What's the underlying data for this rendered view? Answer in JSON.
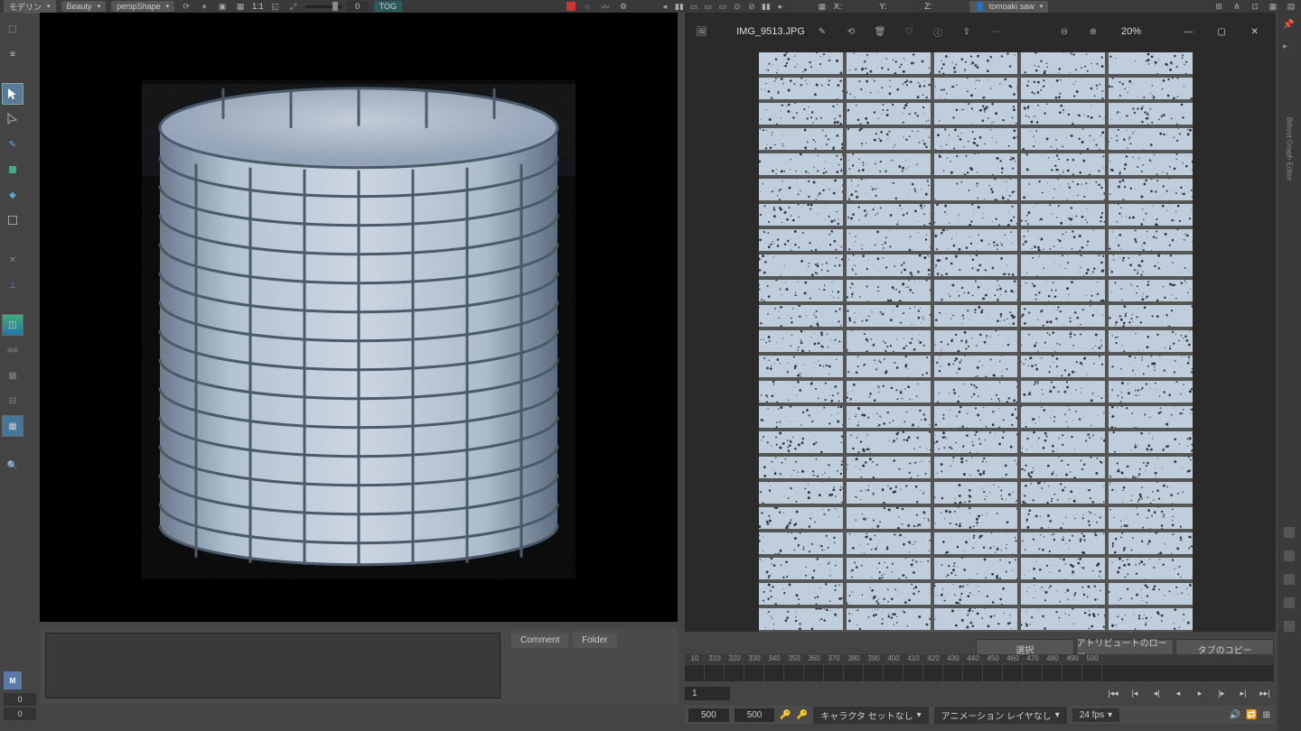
{
  "topbar": {
    "mode": "モデリン",
    "render_mode": "Beauty",
    "camera": "perspShape",
    "ratio": "1:1",
    "zero": "0",
    "tog": "TOG",
    "x": "X:",
    "y": "Y:",
    "z": "Z:",
    "user": "tomoaki saw"
  },
  "image_viewer": {
    "filename": "IMG_9513.JPG",
    "zoom": "20%"
  },
  "bottom_tabs": {
    "comment": "Comment",
    "folder": "Folder"
  },
  "buttons": {
    "select": "選択",
    "load_attr": "アトリビュートのロード",
    "copy_tab": "タブのコピー"
  },
  "timeline": {
    "frames": [
      "10",
      "310",
      "320",
      "330",
      "340",
      "350",
      "360",
      "370",
      "380",
      "390",
      "400",
      "410",
      "420",
      "430",
      "440",
      "450",
      "460",
      "470",
      "480",
      "490",
      "500"
    ],
    "current": "1"
  },
  "status": {
    "start": "500",
    "end": "500",
    "charset": "キャラクタ セットなし",
    "anim_layer": "アニメーション レイヤなし",
    "fps": "24 fps"
  },
  "leftfoot": {
    "m": "M",
    "zero": "0",
    "zero2": "0"
  },
  "rightslim": {
    "label": "Bifrost Graph Editor"
  }
}
